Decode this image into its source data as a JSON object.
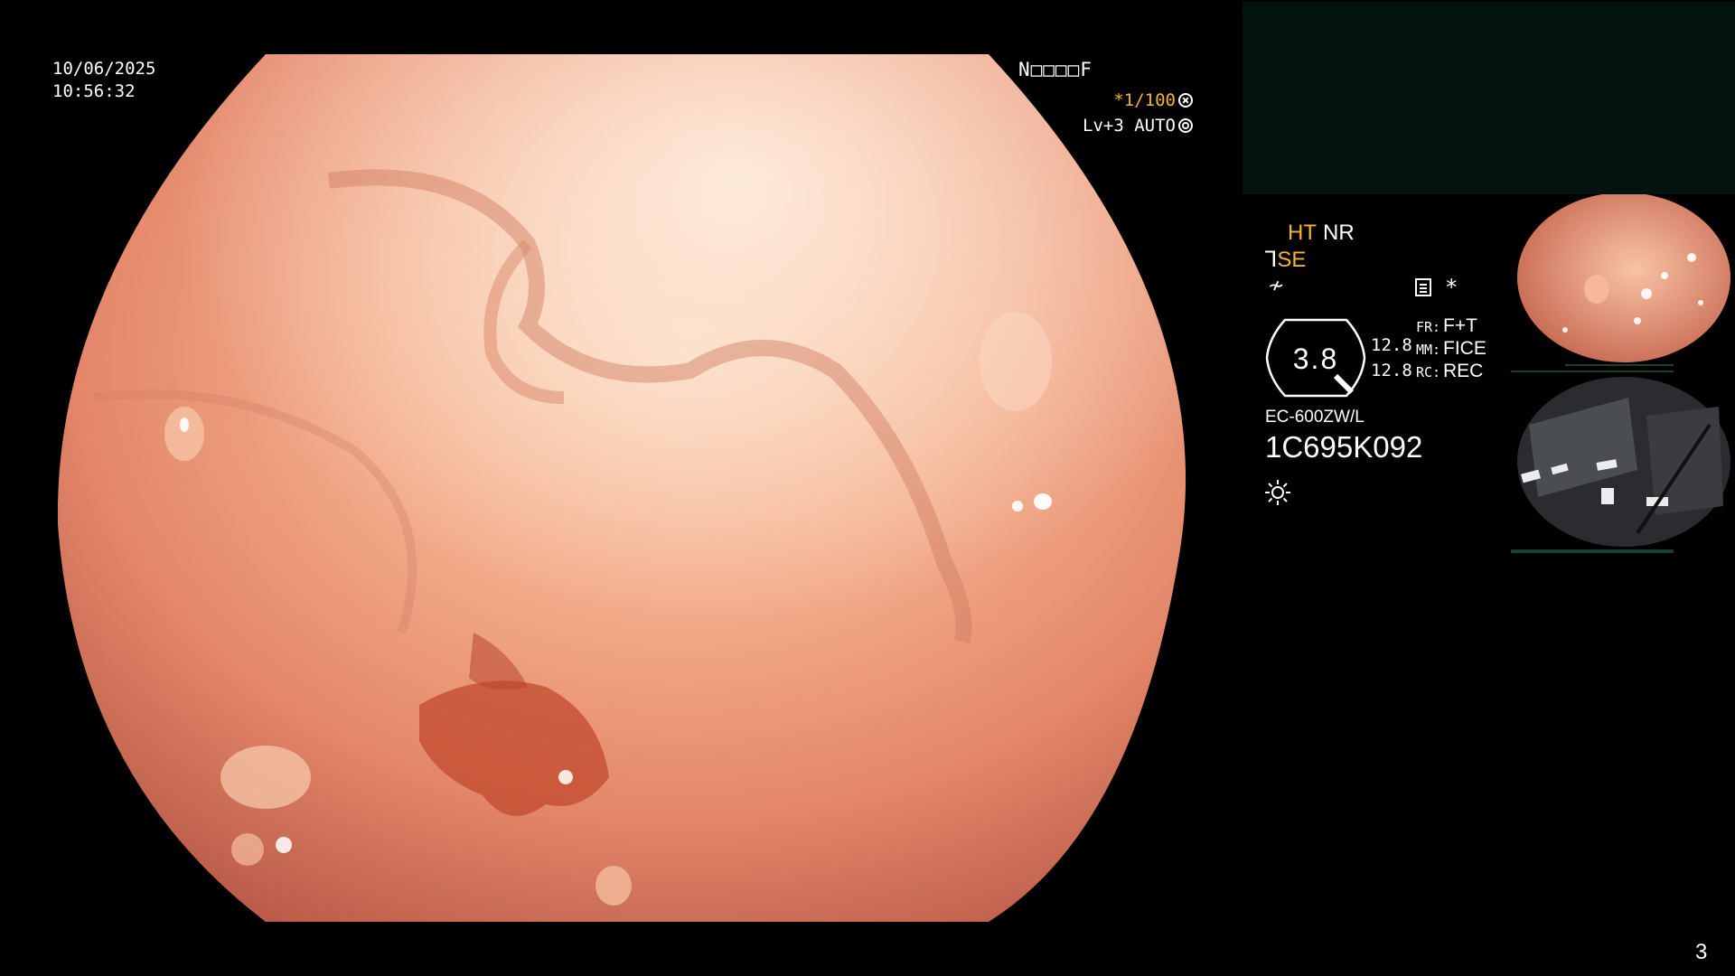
{
  "overlay": {
    "date": "10/06/2025",
    "time": "10:56:32",
    "patient_name": "N□□□□F",
    "shutter_prefix": "*1/100",
    "level_text": "Lv+3 AUTO",
    "page_number": "3"
  },
  "status": {
    "ht_label": "HT",
    "nr_label": "NR",
    "se_label": "SE",
    "wave_icon": "wave-icon",
    "memo_icon": "grid-icon",
    "star": "*",
    "zoom_value": "3.8",
    "num_1": "12.8",
    "num_2": "12.8",
    "fr_key": "FR:",
    "fr_value": "F+T",
    "mm_key": "MM:",
    "mm_value": "FICE",
    "rc_key": "RC:",
    "rc_value": "REC",
    "scope_model": "EC-600ZW/L",
    "serial_number": "1C695K092",
    "light_icon": "sun-icon"
  },
  "colors": {
    "amber": "#f2b531",
    "panel_green": "#03140f",
    "mucosa": "#e58a6a"
  }
}
